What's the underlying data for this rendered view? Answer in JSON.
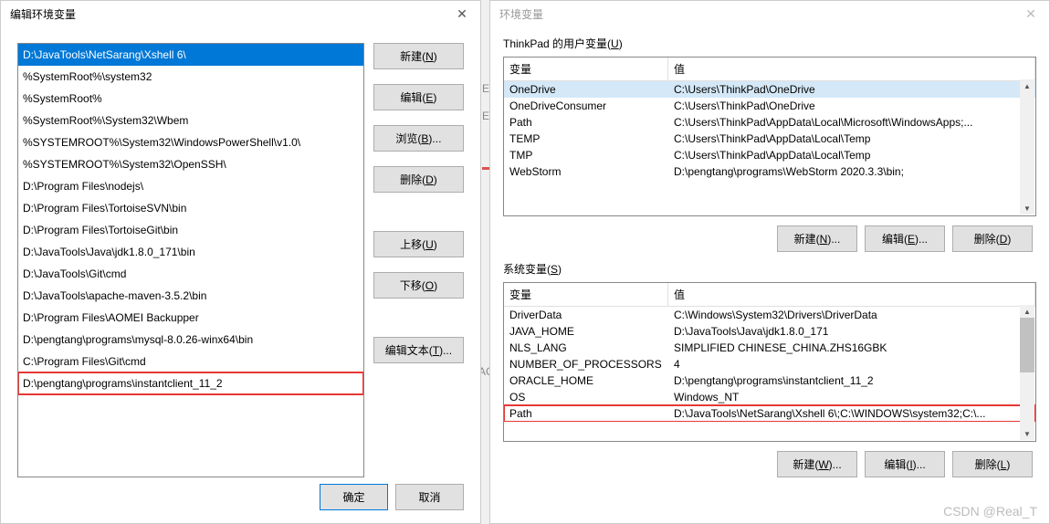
{
  "leftDialog": {
    "title": "编辑环境变量",
    "items": [
      "D:\\JavaTools\\NetSarang\\Xshell 6\\",
      "%SystemRoot%\\system32",
      "%SystemRoot%",
      "%SystemRoot%\\System32\\Wbem",
      "%SYSTEMROOT%\\System32\\WindowsPowerShell\\v1.0\\",
      "%SYSTEMROOT%\\System32\\OpenSSH\\",
      "D:\\Program Files\\nodejs\\",
      "D:\\Program Files\\TortoiseSVN\\bin",
      "D:\\Program Files\\TortoiseGit\\bin",
      "D:\\JavaTools\\Java\\jdk1.8.0_171\\bin",
      "D:\\JavaTools\\Git\\cmd",
      "D:\\JavaTools\\apache-maven-3.5.2\\bin",
      "D:\\Program Files\\AOMEI Backupper",
      "D:\\pengtang\\programs\\mysql-8.0.26-winx64\\bin",
      "C:\\Program Files\\Git\\cmd",
      "D:\\pengtang\\programs\\instantclient_11_2"
    ],
    "buttons": {
      "new": "新建(N)",
      "edit": "编辑(E)",
      "browse": "浏览(B)...",
      "delete": "删除(D)",
      "moveUp": "上移(U)",
      "moveDown": "下移(O)",
      "editText": "编辑文本(T)..."
    },
    "ok": "确定",
    "cancel": "取消"
  },
  "rightDialog": {
    "title": "环境变量",
    "userVarsLabel": "ThinkPad 的用户变量(U)",
    "sysVarsLabel": "系统变量(S)",
    "headers": {
      "var": "变量",
      "val": "值"
    },
    "userVars": [
      {
        "var": "OneDrive",
        "val": "C:\\Users\\ThinkPad\\OneDrive"
      },
      {
        "var": "OneDriveConsumer",
        "val": "C:\\Users\\ThinkPad\\OneDrive"
      },
      {
        "var": "Path",
        "val": "C:\\Users\\ThinkPad\\AppData\\Local\\Microsoft\\WindowsApps;..."
      },
      {
        "var": "TEMP",
        "val": "C:\\Users\\ThinkPad\\AppData\\Local\\Temp"
      },
      {
        "var": "TMP",
        "val": "C:\\Users\\ThinkPad\\AppData\\Local\\Temp"
      },
      {
        "var": "WebStorm",
        "val": "D:\\pengtang\\programs\\WebStorm 2020.3.3\\bin;"
      }
    ],
    "sysVars": [
      {
        "var": "DriverData",
        "val": "C:\\Windows\\System32\\Drivers\\DriverData"
      },
      {
        "var": "JAVA_HOME",
        "val": "D:\\JavaTools\\Java\\jdk1.8.0_171"
      },
      {
        "var": "NLS_LANG",
        "val": "SIMPLIFIED CHINESE_CHINA.ZHS16GBK"
      },
      {
        "var": "NUMBER_OF_PROCESSORS",
        "val": "4"
      },
      {
        "var": "ORACLE_HOME",
        "val": "D:\\pengtang\\programs\\instantclient_11_2"
      },
      {
        "var": "OS",
        "val": "Windows_NT"
      },
      {
        "var": "Path",
        "val": "D:\\JavaTools\\NetSarang\\Xshell 6\\;C:\\WINDOWS\\system32;C:\\..."
      }
    ],
    "buttons": {
      "new": "新建(N)...",
      "edit": "编辑(E)...",
      "delete": "删除(D)",
      "newSys": "新建(W)...",
      "editSys": "编辑(I)...",
      "deleteSys": "删除(L)"
    }
  },
  "bgText": {
    "e": "E",
    "ev": "EV",
    "ac": "AC"
  },
  "watermark": "CSDN @Real_T"
}
